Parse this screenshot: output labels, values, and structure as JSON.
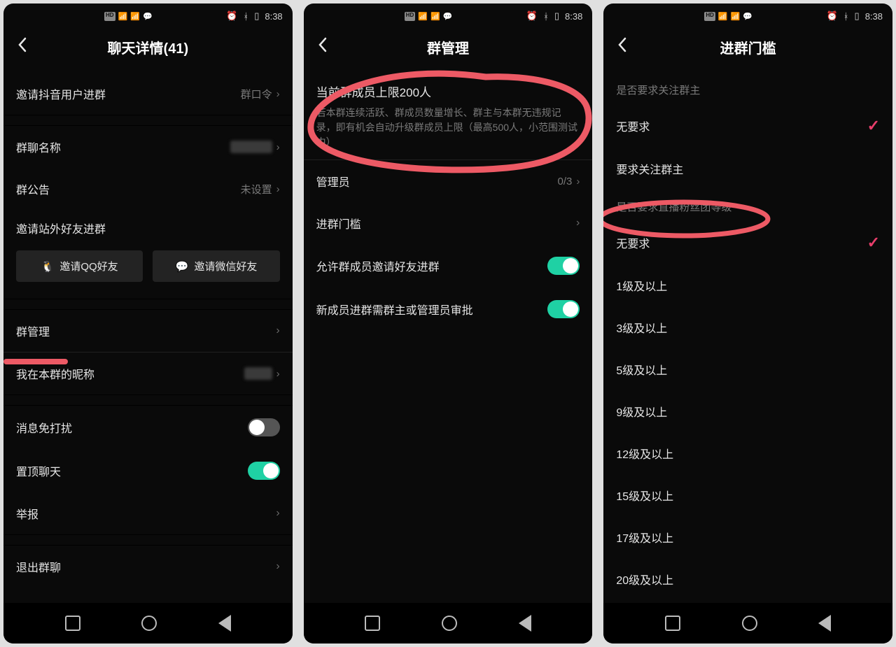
{
  "statusbar": {
    "hd1": "HD",
    "hd2": "HD",
    "sig1": "4G",
    "sig2": "4G",
    "icons": "⏰ ⚲ ▮◻",
    "time": "8:38"
  },
  "screen1": {
    "title": "聊天详情(41)",
    "invite_users": "邀请抖音用户进群",
    "invite_users_val": "群口令",
    "group_name": "群聊名称",
    "group_notice": "群公告",
    "group_notice_val": "未设置",
    "invite_ext": "邀请站外好友进群",
    "invite_qq": "邀请QQ好友",
    "invite_wx": "邀请微信好友",
    "management": "群管理",
    "my_nick": "我在本群的昵称",
    "mute": "消息免打扰",
    "pin": "置顶聊天",
    "report": "举报",
    "leave": "退出群聊"
  },
  "screen2": {
    "title": "群管理",
    "limit_title": "当前群成员上限200人",
    "limit_desc": "若本群连续活跃、群成员数量增长、群主与本群无违规记录，即有机会自动升级群成员上限（最高500人，小范围测试中）",
    "admin": "管理员",
    "admin_val": "0/3",
    "threshold": "进群门槛",
    "allow_invite": "允许群成员邀请好友进群",
    "approve": "新成员进群需群主或管理员审批"
  },
  "screen3": {
    "title": "进群门槛",
    "section_follow": "是否要求关注群主",
    "no_req": "无要求",
    "req_follow": "要求关注群主",
    "section_level": "是否要求直播粉丝团等级",
    "levels": [
      "无要求",
      "1级及以上",
      "3级及以上",
      "5级及以上",
      "9级及以上",
      "12级及以上",
      "15级及以上",
      "17级及以上",
      "20级及以上"
    ]
  }
}
